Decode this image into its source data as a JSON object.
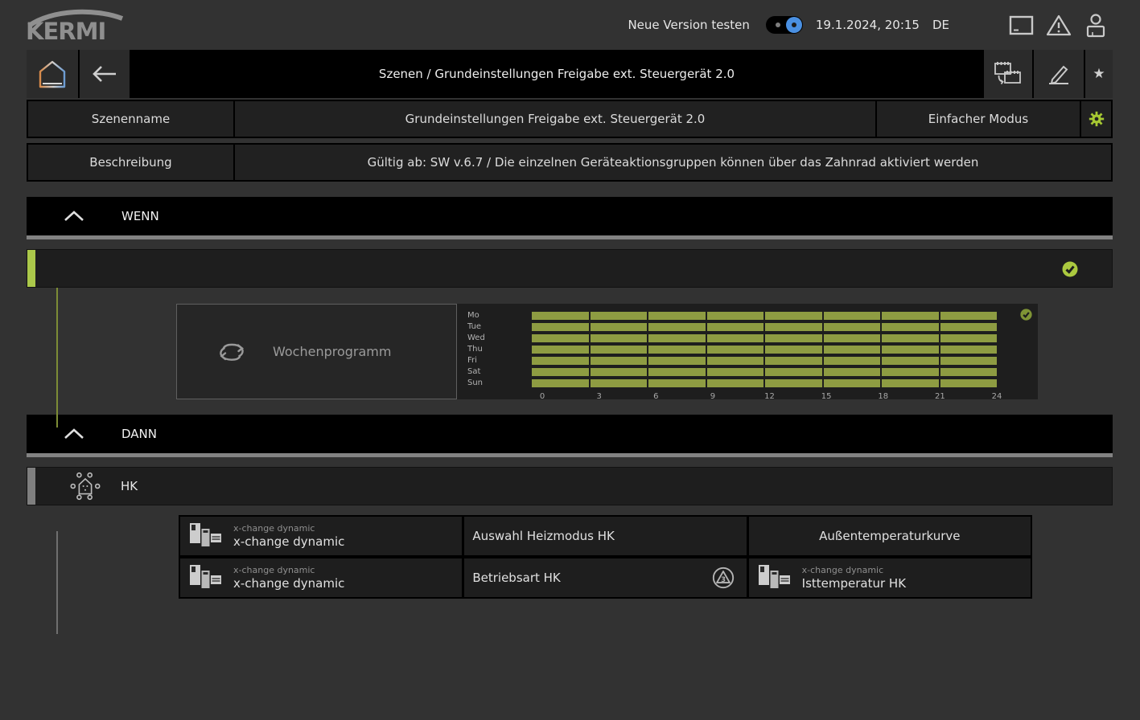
{
  "colors": {
    "accent_green": "#abc84a",
    "schedule_green": "#8e9c42",
    "toggle_blue": "#4a90e2",
    "background": "#323232"
  },
  "topbar": {
    "logo": "KERMI",
    "new_version_label": "Neue Version testen",
    "datetime": "19.1.2024, 20:15",
    "language": "DE"
  },
  "icons": {
    "star": "★"
  },
  "nav": {
    "title": "Szenen / Grundeinstellungen Freigabe ext. Steuergerät 2.0"
  },
  "scene": {
    "name_label": "Szenenname",
    "name_value": "Grundeinstellungen Freigabe ext. Steuergerät 2.0",
    "mode_label": "Einfacher Modus",
    "description_label": "Beschreibung",
    "description_value": "Gültig ab: SW v.6.7 / Die einzelnen Geräteaktionsgruppen können über das Zahnrad aktiviert werden"
  },
  "sections": {
    "wenn": "WENN",
    "dann": "DANN"
  },
  "condition": {
    "widget_label": "Wochenprogramm"
  },
  "week_program": {
    "days": [
      "Mo",
      "Tue",
      "Wed",
      "Thu",
      "Fri",
      "Sat",
      "Sun"
    ],
    "hour_ticks": [
      "0",
      "3",
      "6",
      "9",
      "12",
      "15",
      "18",
      "21",
      "24"
    ],
    "segments_per_day": 8,
    "hours_range": [
      0,
      24
    ],
    "active_intervals": [
      [
        [
          0,
          24
        ]
      ],
      [
        [
          0,
          24
        ]
      ],
      [
        [
          0,
          24
        ]
      ],
      [
        [
          0,
          24
        ]
      ],
      [
        [
          0,
          24
        ]
      ],
      [
        [
          0,
          24
        ]
      ],
      [
        [
          0,
          24
        ]
      ]
    ]
  },
  "group": {
    "label": "HK"
  },
  "actions": {
    "rows": [
      {
        "device": {
          "sub": "x-change dynamic",
          "name": "x-change dynamic"
        },
        "action": {
          "label": "Auswahl Heizmodus HK"
        },
        "extra": {
          "label": "Außentemperaturkurve"
        }
      },
      {
        "device": {
          "sub": "x-change dynamic",
          "name": "x-change dynamic"
        },
        "action": {
          "label": "Betriebsart HK",
          "mode_badge": "3"
        },
        "extra": {
          "sub": "x-change dynamic",
          "name": "Isttemperatur HK"
        }
      }
    ]
  }
}
